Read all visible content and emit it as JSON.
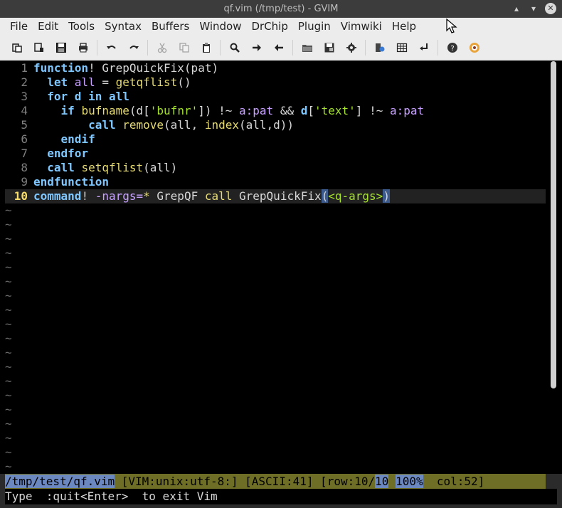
{
  "window": {
    "title": "qf.vim (/tmp/test) - GVIM",
    "controls": [
      "▴",
      "▾",
      "✕"
    ]
  },
  "menubar": [
    "File",
    "Edit",
    "Tools",
    "Syntax",
    "Buffers",
    "Window",
    "DrChip",
    "Plugin",
    "Vimwiki",
    "Help"
  ],
  "toolbar": [
    "open-icon",
    "save-session-icon",
    "save-icon",
    "print-icon",
    "separator",
    "undo-icon",
    "redo-icon",
    "separator",
    "cut-icon",
    "copy-icon",
    "paste-icon",
    "separator",
    "find-icon",
    "find-next-icon",
    "find-prev-icon",
    "separator",
    "load-session-icon",
    "save-session-disk-icon",
    "run-script-icon",
    "separator",
    "make-icon",
    "tags-icon",
    "jump-tag-icon",
    "separator",
    "help-icon",
    "find-help-icon"
  ],
  "editor": {
    "lines": [
      {
        "n": "1",
        "tokens": [
          [
            "kw",
            "function"
          ],
          [
            "op",
            "! "
          ],
          [
            "txt",
            "GrepQuickFix(pat)"
          ]
        ]
      },
      {
        "n": "2",
        "tokens": [
          [
            "txt",
            "  "
          ],
          [
            "kw",
            "let "
          ],
          [
            "var",
            "all"
          ],
          [
            "op",
            " = "
          ],
          [
            "fn",
            "getqflist"
          ],
          [
            "txt",
            "()"
          ]
        ]
      },
      {
        "n": "3",
        "tokens": [
          [
            "txt",
            "  "
          ],
          [
            "kw",
            "for d in all"
          ]
        ]
      },
      {
        "n": "4",
        "tokens": [
          [
            "txt",
            "    "
          ],
          [
            "kw",
            "if "
          ],
          [
            "fn",
            "bufname"
          ],
          [
            "txt",
            "(d["
          ],
          [
            "str",
            "'bufnr'"
          ],
          [
            "txt",
            "]) !~ "
          ],
          [
            "var",
            "a:pat"
          ],
          [
            "txt",
            " && "
          ],
          [
            "kw",
            "d"
          ],
          [
            "txt",
            "["
          ],
          [
            "str",
            "'text'"
          ],
          [
            "txt",
            "] !~ "
          ],
          [
            "var",
            "a:pat"
          ]
        ]
      },
      {
        "n": "5",
        "tokens": [
          [
            "txt",
            "        "
          ],
          [
            "kw",
            "call "
          ],
          [
            "fn",
            "remove"
          ],
          [
            "txt",
            "(all, "
          ],
          [
            "fn",
            "index"
          ],
          [
            "txt",
            "(all,d))"
          ]
        ]
      },
      {
        "n": "6",
        "tokens": [
          [
            "txt",
            "    "
          ],
          [
            "kw",
            "endif"
          ]
        ]
      },
      {
        "n": "7",
        "tokens": [
          [
            "txt",
            "  "
          ],
          [
            "kw",
            "endfor"
          ]
        ]
      },
      {
        "n": "8",
        "tokens": [
          [
            "txt",
            "  "
          ],
          [
            "kw",
            "call "
          ],
          [
            "fn",
            "setqflist"
          ],
          [
            "txt",
            "(all)"
          ]
        ]
      },
      {
        "n": "9",
        "tokens": [
          [
            "kw",
            "endfunction"
          ]
        ]
      },
      {
        "n": "10",
        "tokens": [
          [
            "kw",
            "command"
          ],
          [
            "op",
            "! "
          ],
          [
            "var",
            "-nargs="
          ],
          [
            "fn",
            "* "
          ],
          [
            "txt",
            "GrepQF "
          ],
          [
            "fn",
            "call "
          ],
          [
            "txt",
            "GrepQuickFix"
          ],
          [
            "bm",
            "("
          ],
          [
            "str",
            "<q-args>"
          ],
          [
            "bm",
            ")"
          ]
        ]
      }
    ],
    "tilde_count": 19,
    "tilde": "~"
  },
  "status": {
    "file": "/tmp/test/qf.vim",
    "fileinfo": " [VIM:unix:utf-8:] [ASCII:41] [row:10/",
    "rowtotal": "10",
    "space": " ",
    "percent": "100%",
    "col": "  col:52]"
  },
  "cmdline": "Type  :quit<Enter>  to exit Vim",
  "colors": {
    "background": "#000000",
    "keyword": "#7fc7ff",
    "function": "#e6db74",
    "variable": "#c8a2ff",
    "string": "#a6e22e",
    "statusline": "#6e6e26",
    "statusline_accent": "#6b88c1"
  }
}
